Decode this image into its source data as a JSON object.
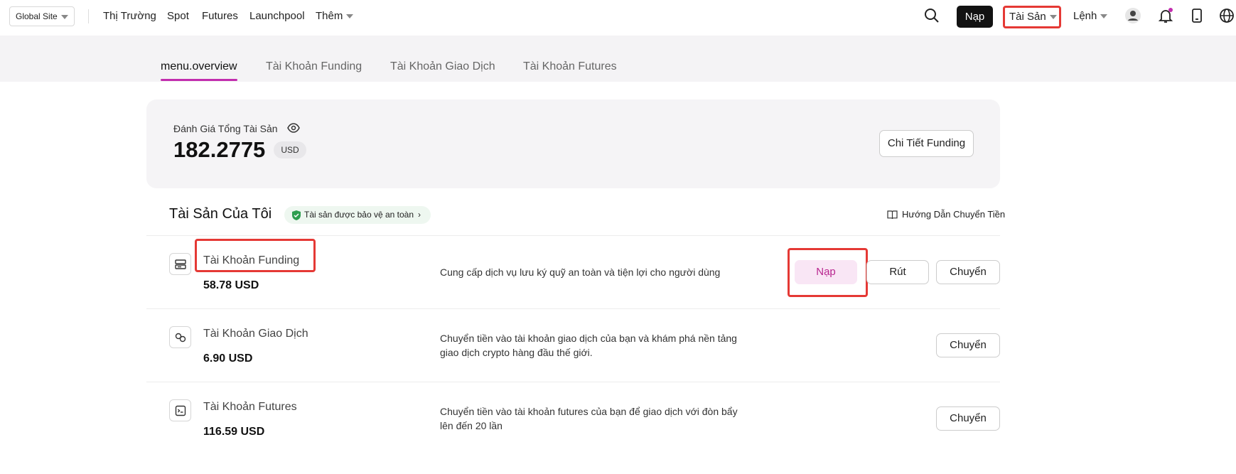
{
  "topbar": {
    "site_select": "Global Site",
    "nav": [
      "Thị Trường",
      "Spot",
      "Futures",
      "Launchpool",
      "Thêm"
    ],
    "deposit_button": "Nạp",
    "assets_menu": "Tài Sản",
    "orders_menu": "Lệnh"
  },
  "tabs": [
    "menu.overview",
    "Tài Khoản Funding",
    "Tài Khoản Giao Dịch",
    "Tài Khoản Futures"
  ],
  "summary": {
    "label": "Đánh Giá Tổng Tài Sản",
    "value": "182.2775",
    "currency": "USD",
    "detail_button": "Chi Tiết Funding"
  },
  "my_assets": {
    "title": "Tài Sản Của Tôi",
    "safe_badge": "Tài sản được bảo vệ an toàn",
    "guide_link": "Hướng Dẫn Chuyển Tiền"
  },
  "accounts": [
    {
      "name": "Tài Khoản Funding",
      "value": "58.78 USD",
      "description": "Cung cấp dịch vụ lưu ký quỹ an toàn và tiện lợi cho người dùng",
      "buttons": [
        "Nạp",
        "Rút",
        "Chuyển"
      ]
    },
    {
      "name": "Tài Khoản Giao Dịch",
      "value": "6.90 USD",
      "description": "Chuyển tiền vào tài khoản giao dịch của bạn và khám phá nền tảng giao dịch crypto hàng đầu thế giới.",
      "buttons": [
        "Chuyển"
      ]
    },
    {
      "name": "Tài Khoản Futures",
      "value": "116.59 USD",
      "description": "Chuyển tiền vào tài khoản futures của bạn để giao dịch với đòn bẩy lên đến 20 lần",
      "buttons": [
        "Chuyển"
      ]
    }
  ],
  "colors": {
    "accent": "#c22dae",
    "highlight": "#e53935",
    "badge_bg": "#eef7f0",
    "shield": "#2e9e4f"
  }
}
